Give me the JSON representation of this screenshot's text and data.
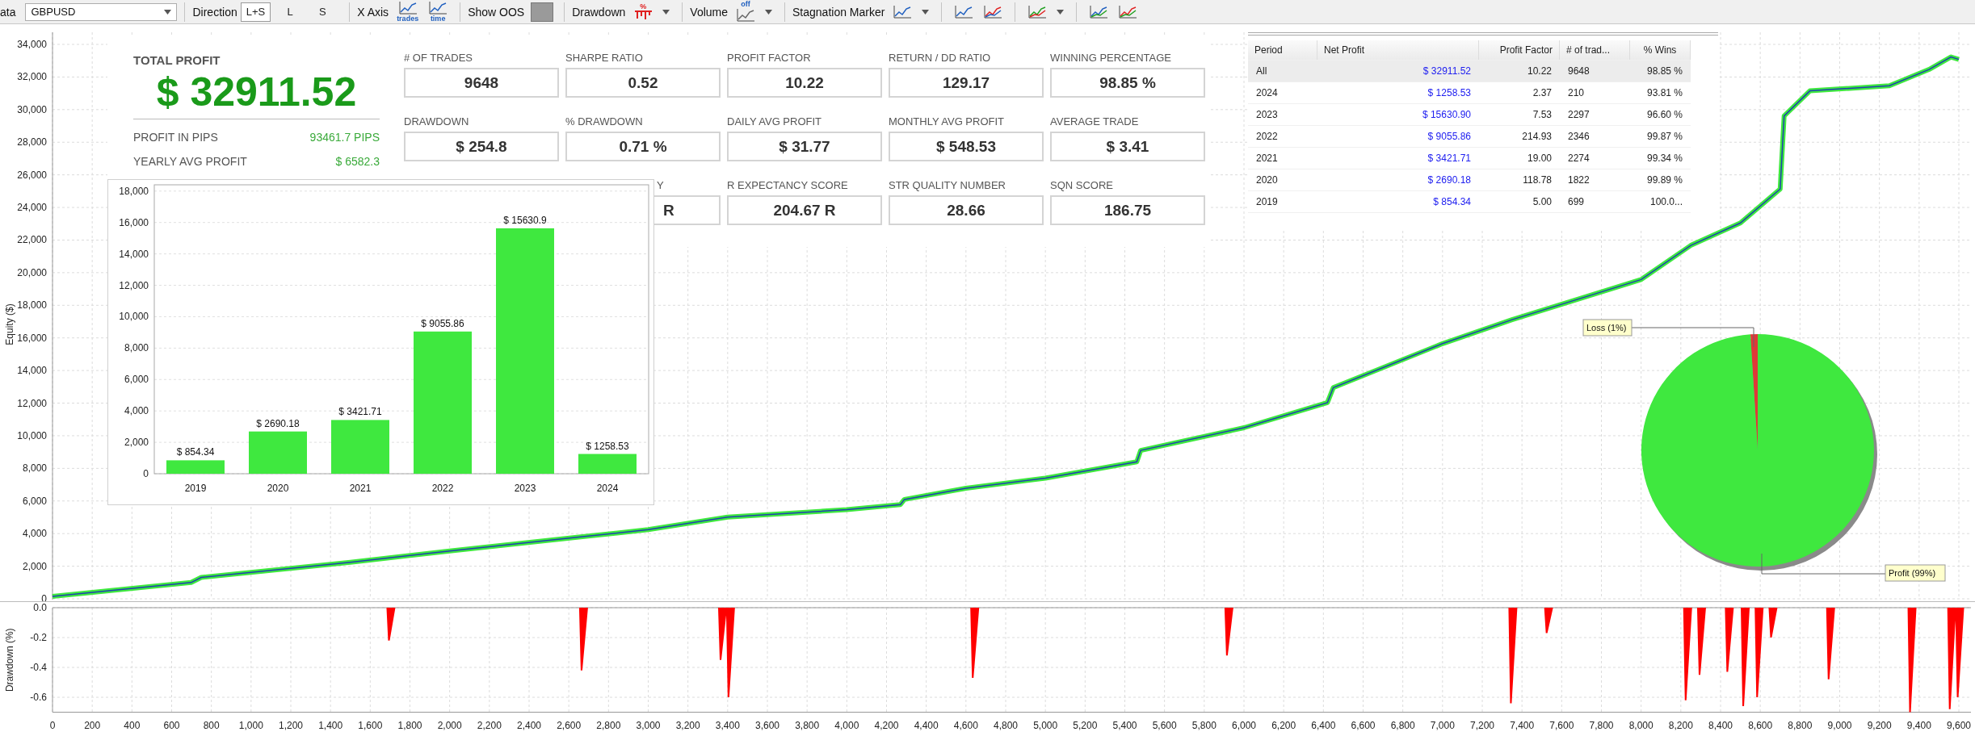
{
  "toolbar": {
    "data_label": "ata",
    "symbol": "GBPUSD",
    "direction_label": "Direction",
    "directions": [
      {
        "label": "L+S",
        "selected": true
      },
      {
        "label": "L",
        "selected": false
      },
      {
        "label": "S",
        "selected": false
      }
    ],
    "x_axis_label": "X Axis",
    "x_axis_options": [
      "trades",
      "time"
    ],
    "show_oos_label": "Show OOS",
    "drawdown_label": "Drawdown",
    "drawdown_icon_text": "%",
    "volume_label": "Volume",
    "volume_icon_text": "off",
    "stagnation_label": "Stagnation Marker"
  },
  "equity_chart": {
    "chart_data": {
      "type": "line",
      "grid": true,
      "ylabel": "Equity ($)",
      "xlim": [
        0,
        9600
      ],
      "ylim": [
        0,
        34000
      ],
      "x": [
        0,
        698,
        749,
        1500,
        2000,
        2650,
        3000,
        3400,
        4000,
        4270,
        4290,
        4600,
        5000,
        5460,
        5480,
        6000,
        6420,
        6450,
        7000,
        7350,
        8000,
        8250,
        8500,
        8700,
        8720,
        8850,
        9250,
        9450,
        9560,
        9600
      ],
      "series": [
        {
          "color": "#3fe83f",
          "values": [
            150,
            1000,
            1310,
            2240,
            2930,
            3780,
            4240,
            5010,
            5470,
            5780,
            6090,
            6780,
            7400,
            8400,
            9100,
            10490,
            12030,
            12950,
            15650,
            17120,
            19580,
            21670,
            23050,
            25130,
            29610,
            31150,
            31460,
            32460,
            33230,
            33080
          ]
        }
      ],
      "yticks": [
        {
          "value": 0,
          "label": "0"
        },
        {
          "value": 2000,
          "label": "2,000"
        },
        {
          "value": 4000,
          "label": "4,000"
        },
        {
          "value": 6000,
          "label": "6,000"
        },
        {
          "value": 8000,
          "label": "8,000"
        },
        {
          "value": 10000,
          "label": "10,000"
        },
        {
          "value": 12000,
          "label": "12,000"
        },
        {
          "value": 14000,
          "label": "14,000"
        },
        {
          "value": 16000,
          "label": "16,000"
        },
        {
          "value": 18000,
          "label": "18,000"
        },
        {
          "value": 20000,
          "label": "20,000"
        },
        {
          "value": 22000,
          "label": "22,000"
        },
        {
          "value": 24000,
          "label": "24,000"
        },
        {
          "value": 26000,
          "label": "26,000"
        },
        {
          "value": 28000,
          "label": "28,000"
        },
        {
          "value": 30000,
          "label": "30,000"
        },
        {
          "value": 32000,
          "label": "32,000"
        },
        {
          "value": 34000,
          "label": "34,000"
        }
      ]
    }
  },
  "summary": {
    "total_profit_label": "TOTAL PROFIT",
    "total_profit": "$ 32911.52",
    "details": [
      {
        "label": "PROFIT IN PIPS",
        "value": "93461.7 PIPS"
      },
      {
        "label": "YEARLY AVG PROFIT",
        "value": "$ 6582.3"
      }
    ],
    "metric_rows": [
      [
        {
          "kind": "full",
          "label": "# OF TRADES",
          "value": "9648"
        },
        {
          "kind": "full",
          "label": "SHARPE RATIO",
          "value": "0.52"
        },
        {
          "kind": "full",
          "label": "PROFIT FACTOR",
          "value": "10.22"
        },
        {
          "kind": "full",
          "label": "RETURN / DD RATIO",
          "value": "129.17"
        },
        {
          "kind": "full",
          "label": "WINNING PERCENTAGE",
          "value": "98.85 %"
        }
      ],
      [
        {
          "kind": "full",
          "label": "DRAWDOWN",
          "value": "$ 254.8"
        },
        {
          "kind": "full",
          "label": "% DRAWDOWN",
          "value": "0.71 %"
        },
        {
          "kind": "full",
          "label": "DAILY AVG PROFIT",
          "value": "$ 31.77"
        },
        {
          "kind": "full",
          "label": "MONTHLY AVG PROFIT",
          "value": "$ 548.53"
        },
        {
          "kind": "full",
          "label": "AVERAGE TRADE",
          "value": "$ 3.41"
        }
      ],
      [
        {
          "kind": "clipped",
          "label": "Y",
          "value": "R"
        },
        {
          "kind": "full",
          "label": "R EXPECTANCY SCORE",
          "value": "204.67 R"
        },
        {
          "kind": "full",
          "label": "STR QUALITY NUMBER",
          "value": "28.66"
        },
        {
          "kind": "full",
          "label": "SQN SCORE",
          "value": "186.75"
        }
      ]
    ]
  },
  "yearly_chart": {
    "chart_data": {
      "type": "bar",
      "categories": [
        "2019",
        "2020",
        "2021",
        "2022",
        "2023",
        "2024"
      ],
      "grid": true,
      "series": [
        {
          "color": "#3fe83f",
          "values": [
            854.34,
            2690.18,
            3421.71,
            9055.86,
            15630.9,
            1258.53
          ]
        }
      ],
      "value_labels": [
        "$ 854.34",
        "$ 2690.18",
        "$ 3421.71",
        "$ 9055.86",
        "$ 15630.9",
        "$ 1258.53"
      ],
      "ylim": [
        0,
        18400
      ],
      "yticks": [
        {
          "value": 0,
          "label": "0"
        },
        {
          "value": 2000,
          "label": "2,000"
        },
        {
          "value": 4000,
          "label": "4,000"
        },
        {
          "value": 6000,
          "label": "6,000"
        },
        {
          "value": 8000,
          "label": "8,000"
        },
        {
          "value": 10000,
          "label": "10,000"
        },
        {
          "value": 12000,
          "label": "12,000"
        },
        {
          "value": 14000,
          "label": "14,000"
        },
        {
          "value": 16000,
          "label": "16,000"
        },
        {
          "value": 18000,
          "label": "18,000"
        }
      ]
    }
  },
  "period_table": {
    "columns": [
      "Period",
      "Net Profit",
      "Profit Factor",
      "# of trad...",
      "% Wins"
    ],
    "rows": [
      {
        "selected": true,
        "cells": [
          "All",
          "$ 32911.52",
          "10.22",
          "9648",
          "98.85 %"
        ]
      },
      {
        "selected": false,
        "cells": [
          "2024",
          "$ 1258.53",
          "2.37",
          "210",
          "93.81 %"
        ]
      },
      {
        "selected": false,
        "cells": [
          "2023",
          "$ 15630.90",
          "7.53",
          "2297",
          "96.60 %"
        ]
      },
      {
        "selected": false,
        "cells": [
          "2022",
          "$ 9055.86",
          "214.93",
          "2346",
          "99.87 %"
        ]
      },
      {
        "selected": false,
        "cells": [
          "2021",
          "$ 3421.71",
          "19.00",
          "2274",
          "99.34 %"
        ]
      },
      {
        "selected": false,
        "cells": [
          "2020",
          "$ 2690.18",
          "118.78",
          "1822",
          "99.89 %"
        ]
      },
      {
        "selected": false,
        "cells": [
          "2019",
          "$ 854.34",
          "5.00",
          "699",
          "100.0..."
        ]
      }
    ]
  },
  "profit_pie": {
    "slices": [
      {
        "color": "#e03838"
      },
      {
        "color": "#3fe83f"
      }
    ],
    "chart_data": {
      "type": "pie",
      "categories": [
        "Loss (1%)",
        "Profit (99%)"
      ],
      "values": [
        1,
        99
      ]
    }
  },
  "drawdown_chart": {
    "chart_data": {
      "type": "area",
      "grid": true,
      "ylabel": "Drawdown (%)",
      "xlim": [
        0,
        9600
      ],
      "ylim": [
        -0.7,
        0
      ],
      "x": [
        1690,
        2660,
        3360,
        3400,
        4630,
        5910,
        7340,
        7520,
        8220,
        8290,
        8430,
        8510,
        8580,
        8650,
        8940,
        9350,
        9550,
        9590
      ],
      "series": [
        {
          "color": "#ff0000",
          "values": [
            -0.22,
            -0.42,
            -0.35,
            -0.6,
            -0.47,
            -0.32,
            -0.64,
            -0.17,
            -0.62,
            -0.45,
            -0.43,
            -0.66,
            -0.6,
            -0.2,
            -0.48,
            -0.7,
            -0.68,
            -0.6
          ]
        }
      ],
      "yticks": [
        {
          "value": 0,
          "label": "0.0"
        },
        {
          "value": -0.2,
          "label": "-0.2"
        },
        {
          "value": -0.4,
          "label": "-0.4"
        },
        {
          "value": -0.6,
          "label": "-0.6"
        }
      ],
      "xticks": [
        {
          "value": 0,
          "label": "0"
        },
        {
          "value": 200,
          "label": "200"
        },
        {
          "value": 400,
          "label": "400"
        },
        {
          "value": 600,
          "label": "600"
        },
        {
          "value": 800,
          "label": "800"
        },
        {
          "value": 1000,
          "label": "1,000"
        },
        {
          "value": 1200,
          "label": "1,200"
        },
        {
          "value": 1400,
          "label": "1,400"
        },
        {
          "value": 1600,
          "label": "1,600"
        },
        {
          "value": 1800,
          "label": "1,800"
        },
        {
          "value": 2000,
          "label": "2,000"
        },
        {
          "value": 2200,
          "label": "2,200"
        },
        {
          "value": 2400,
          "label": "2,400"
        },
        {
          "value": 2600,
          "label": "2,600"
        },
        {
          "value": 2800,
          "label": "2,800"
        },
        {
          "value": 3000,
          "label": "3,000"
        },
        {
          "value": 3200,
          "label": "3,200"
        },
        {
          "value": 3400,
          "label": "3,400"
        },
        {
          "value": 3600,
          "label": "3,600"
        },
        {
          "value": 3800,
          "label": "3,800"
        },
        {
          "value": 4000,
          "label": "4,000"
        },
        {
          "value": 4200,
          "label": "4,200"
        },
        {
          "value": 4400,
          "label": "4,400"
        },
        {
          "value": 4600,
          "label": "4,600"
        },
        {
          "value": 4800,
          "label": "4,800"
        },
        {
          "value": 5000,
          "label": "5,000"
        },
        {
          "value": 5200,
          "label": "5,200"
        },
        {
          "value": 5400,
          "label": "5,400"
        },
        {
          "value": 5600,
          "label": "5,600"
        },
        {
          "value": 5800,
          "label": "5,800"
        },
        {
          "value": 6000,
          "label": "6,000"
        },
        {
          "value": 6200,
          "label": "6,200"
        },
        {
          "value": 6400,
          "label": "6,400"
        },
        {
          "value": 6600,
          "label": "6,600"
        },
        {
          "value": 6800,
          "label": "6,800"
        },
        {
          "value": 7000,
          "label": "7,000"
        },
        {
          "value": 7200,
          "label": "7,200"
        },
        {
          "value": 7400,
          "label": "7,400"
        },
        {
          "value": 7600,
          "label": "7,600"
        },
        {
          "value": 7800,
          "label": "7,800"
        },
        {
          "value": 8000,
          "label": "8,000"
        },
        {
          "value": 8200,
          "label": "8,200"
        },
        {
          "value": 8400,
          "label": "8,400"
        },
        {
          "value": 8600,
          "label": "8,600"
        },
        {
          "value": 8800,
          "label": "8,800"
        },
        {
          "value": 9000,
          "label": "9,000"
        },
        {
          "value": 9200,
          "label": "9,200"
        },
        {
          "value": 9400,
          "label": "9,400"
        },
        {
          "value": 9600,
          "label": "9,600"
        }
      ]
    }
  }
}
